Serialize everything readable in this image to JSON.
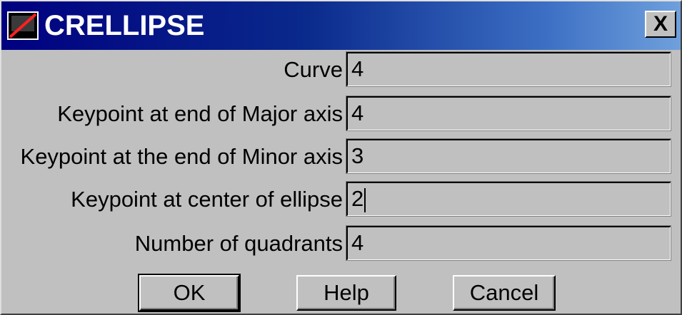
{
  "window": {
    "title": "CRELLIPSE",
    "close_label": "X"
  },
  "fields": [
    {
      "label": "Curve",
      "value": "4"
    },
    {
      "label": "Keypoint at end of Major axis",
      "value": "4"
    },
    {
      "label": "Keypoint at the end of Minor axis",
      "value": "3"
    },
    {
      "label": "Keypoint at center of ellipse",
      "value": "2"
    },
    {
      "label": "Number of quadrants",
      "value": "4"
    }
  ],
  "buttons": {
    "ok": "OK",
    "help": "Help",
    "cancel": "Cancel"
  },
  "colors": {
    "title_bar_start": "#000080",
    "title_bar_end": "#6fa0dc",
    "face": "#c0c0c0"
  },
  "icons": {
    "title_icon": "app-icon",
    "close_icon": "close-icon"
  }
}
